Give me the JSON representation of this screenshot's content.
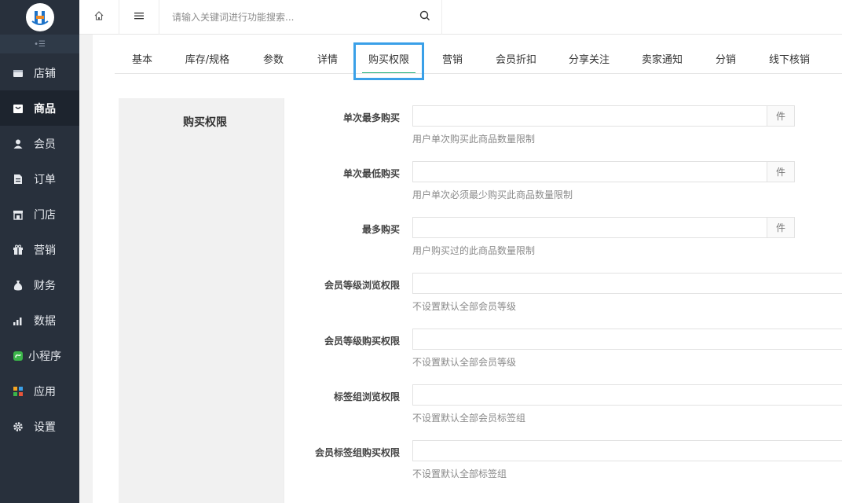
{
  "sidebar": {
    "collapse_label": "•☰",
    "items": [
      {
        "label": "店铺",
        "icon": "store-icon"
      },
      {
        "label": "商品",
        "icon": "goods-icon"
      },
      {
        "label": "会员",
        "icon": "user-icon"
      },
      {
        "label": "订单",
        "icon": "order-icon"
      },
      {
        "label": "门店",
        "icon": "shop-icon"
      },
      {
        "label": "营销",
        "icon": "gift-icon"
      },
      {
        "label": "财务",
        "icon": "money-bag-icon"
      },
      {
        "label": "数据",
        "icon": "bar-chart-icon"
      },
      {
        "label": "小程序",
        "icon": "mini-program-icon"
      },
      {
        "label": "应用",
        "icon": "apps-icon"
      },
      {
        "label": "设置",
        "icon": "gear-icon"
      }
    ],
    "active_index": 1
  },
  "topbar": {
    "search_placeholder": "请输入关键词进行功能搜索..."
  },
  "tabs": {
    "items": [
      "基本",
      "库存/规格",
      "参数",
      "详情",
      "购买权限",
      "营销",
      "会员折扣",
      "分享关注",
      "卖家通知",
      "分销",
      "线下核销"
    ],
    "active_index": 4
  },
  "section": {
    "title": "购买权限"
  },
  "form": {
    "fields": [
      {
        "label": "单次最多购买",
        "value": "",
        "unit": "件",
        "hint": "用户单次购买此商品数量限制"
      },
      {
        "label": "单次最低购买",
        "value": "",
        "unit": "件",
        "hint": "用户单次必须最少购买此商品数量限制"
      },
      {
        "label": "最多购买",
        "value": "",
        "unit": "件",
        "hint": "用户购买过的此商品数量限制"
      },
      {
        "label": "会员等级浏览权限",
        "value": "",
        "hint": "不设置默认全部会员等级"
      },
      {
        "label": "会员等级购买权限",
        "value": "",
        "hint": "不设置默认全部会员等级"
      },
      {
        "label": "标签组浏览权限",
        "value": "",
        "hint": "不设置默认全部会员标签组"
      },
      {
        "label": "会员标签组购买权限",
        "value": "",
        "hint": "不设置默认全部标签组"
      }
    ]
  },
  "colors": {
    "sidebar_bg": "#28303c",
    "active_tab_border": "#3aa0e8",
    "active_underline": "#2ab37e"
  }
}
